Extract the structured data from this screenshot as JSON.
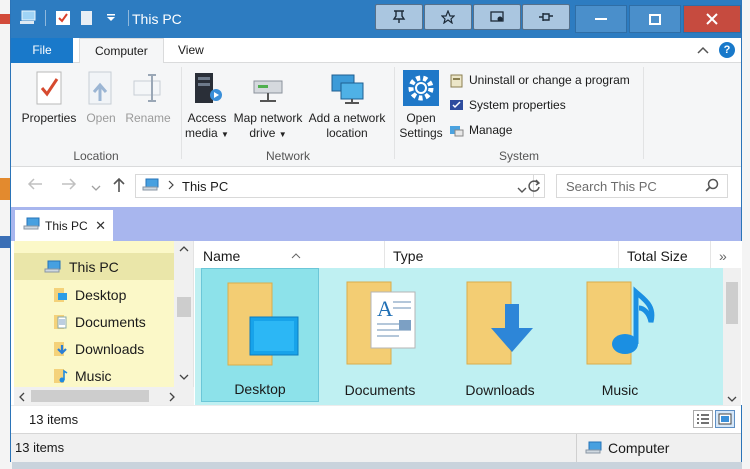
{
  "window": {
    "title": "This PC"
  },
  "title_tools": [
    "pin-tool-1",
    "pin-tool-2",
    "pin-tool-3",
    "pin-tool-4"
  ],
  "ribbon_tabs": {
    "file": "File",
    "computer": "Computer",
    "view": "View"
  },
  "ribbon": {
    "location": {
      "label": "Location",
      "properties": "Properties",
      "open": "Open",
      "rename": "Rename"
    },
    "network": {
      "label": "Network",
      "access_media_1": "Access",
      "access_media_2": "media",
      "map_drive_1": "Map network",
      "map_drive_2": "drive",
      "add_location_1": "Add a network",
      "add_location_2": "location"
    },
    "system": {
      "label": "System",
      "open_settings_1": "Open",
      "open_settings_2": "Settings",
      "uninstall": "Uninstall or change a program",
      "sys_props": "System properties",
      "manage": "Manage"
    }
  },
  "address": {
    "path": "This PC",
    "search_placeholder": "Search This PC"
  },
  "tab": {
    "label": "This PC"
  },
  "nav": {
    "items": [
      {
        "label": "This PC",
        "icon": "computer-icon",
        "selected": true
      },
      {
        "label": "Desktop",
        "icon": "folder-icon"
      },
      {
        "label": "Documents",
        "icon": "documents-icon"
      },
      {
        "label": "Downloads",
        "icon": "downloads-icon"
      },
      {
        "label": "Music",
        "icon": "music-icon"
      }
    ]
  },
  "columns": {
    "name": "Name",
    "type": "Type",
    "total_size": "Total Size",
    "more": "»"
  },
  "files": [
    {
      "label": "Desktop",
      "icon": "desktop-folder-icon",
      "selected": true
    },
    {
      "label": "Documents",
      "icon": "documents-folder-icon"
    },
    {
      "label": "Downloads",
      "icon": "downloads-folder-icon"
    },
    {
      "label": "Music",
      "icon": "music-folder-icon"
    }
  ],
  "status": {
    "items_inner": "13 items",
    "items_outer": "13 items",
    "location": "Computer"
  },
  "colors": {
    "titlebar": "#2d7cc1",
    "file_tab": "#1979ca",
    "tabstrip": "#a8b6ee",
    "navpane": "#fbf8c8",
    "items_bg": "#bff0f2",
    "selected_tile": "#8de2ea"
  }
}
